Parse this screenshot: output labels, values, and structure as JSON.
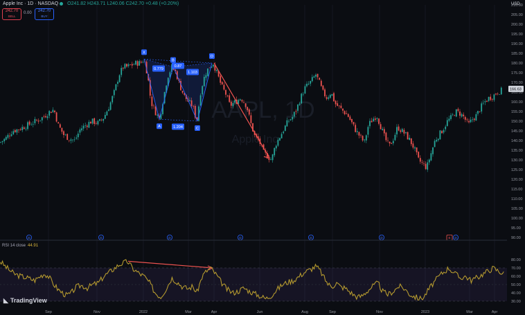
{
  "header": {
    "title": "Apple Inc · 1D · NASDAQ",
    "ohlc": "O241.82 H243.71 L240.06 C242.70 +0.48 (+0.20%)",
    "sell_value": "242.70",
    "sell_label": "SELL",
    "spread": "0.00",
    "buy_value": "242.70",
    "buy_label": "BUY",
    "currency": "USD"
  },
  "watermark": {
    "symbol": "AAPL, 1D",
    "name": "Apple Inc"
  },
  "rsi": {
    "label": "RSI 14 close",
    "value": "44.91"
  },
  "branding": "TradingView",
  "colors": {
    "up": "#26a69a",
    "down": "#ef5350",
    "pattern": "#2962ff",
    "arrow": "#ef5350",
    "rsi": "#b59a2f"
  },
  "pattern": {
    "points": [
      {
        "label": "X",
        "value": 182
      },
      {
        "label": "A",
        "value": 151
      },
      {
        "label": "B",
        "value": 178
      },
      {
        "label": "C",
        "value": 150
      },
      {
        "label": "D",
        "value": 180
      }
    ],
    "ratios": [
      "0.779",
      "0.87",
      "1.204",
      "1.103"
    ]
  },
  "events": [
    {
      "label": "D",
      "color": "#2962ff"
    },
    {
      "label": "E",
      "color": "#ef5350"
    }
  ],
  "chart_data": {
    "type": "candlestick",
    "price_axis": {
      "ylim": [
        90,
        210
      ],
      "ticks": [
        "210.00",
        "205.00",
        "200.00",
        "195.00",
        "190.00",
        "185.00",
        "180.00",
        "175.00",
        "170.00",
        "165.00",
        "160.00",
        "155.00",
        "150.00",
        "145.00",
        "140.00",
        "135.00",
        "130.00",
        "125.00",
        "120.00",
        "115.00",
        "110.00",
        "105.00",
        "100.00",
        "95.00",
        "90.00"
      ],
      "last_price": "166.63"
    },
    "x_ticks": [
      "Sep",
      "Nov",
      "2022",
      "Mar",
      "Apr",
      "Jun",
      "Aug",
      "Sep",
      "Nov",
      "2023",
      "Mar",
      "Apr"
    ],
    "close_path": [
      [
        0,
        139
      ],
      [
        8,
        141
      ],
      [
        18,
        145
      ],
      [
        28,
        146
      ],
      [
        40,
        148
      ],
      [
        52,
        150
      ],
      [
        62,
        152
      ],
      [
        72,
        155
      ],
      [
        78,
        156
      ],
      [
        84,
        148
      ],
      [
        92,
        143
      ],
      [
        100,
        141
      ],
      [
        108,
        140
      ],
      [
        116,
        146
      ],
      [
        124,
        148
      ],
      [
        132,
        150
      ],
      [
        142,
        149
      ],
      [
        150,
        152
      ],
      [
        158,
        158
      ],
      [
        165,
        165
      ],
      [
        172,
        174
      ],
      [
        178,
        178
      ],
      [
        184,
        178
      ],
      [
        190,
        179
      ],
      [
        197,
        180
      ],
      [
        203,
        180
      ],
      [
        208,
        182
      ],
      [
        213,
        174
      ],
      [
        218,
        160
      ],
      [
        224,
        155
      ],
      [
        230,
        151
      ],
      [
        236,
        162
      ],
      [
        242,
        173
      ],
      [
        248,
        178
      ],
      [
        254,
        175
      ],
      [
        260,
        168
      ],
      [
        266,
        163
      ],
      [
        272,
        160
      ],
      [
        278,
        158
      ],
      [
        284,
        150
      ],
      [
        290,
        166
      ],
      [
        296,
        174
      ],
      [
        302,
        178
      ],
      [
        308,
        180
      ],
      [
        314,
        174
      ],
      [
        320,
        168
      ],
      [
        326,
        164
      ],
      [
        332,
        158
      ],
      [
        340,
        160
      ],
      [
        348,
        162
      ],
      [
        356,
        158
      ],
      [
        362,
        149
      ],
      [
        368,
        142
      ],
      [
        374,
        140
      ],
      [
        380,
        134
      ],
      [
        386,
        132
      ],
      [
        392,
        130
      ],
      [
        398,
        138
      ],
      [
        404,
        142
      ],
      [
        410,
        146
      ],
      [
        416,
        150
      ],
      [
        422,
        152
      ],
      [
        428,
        156
      ],
      [
        434,
        162
      ],
      [
        440,
        167
      ],
      [
        448,
        170
      ],
      [
        456,
        174
      ],
      [
        461,
        170
      ],
      [
        466,
        165
      ],
      [
        472,
        162
      ],
      [
        478,
        165
      ],
      [
        484,
        159
      ],
      [
        490,
        157
      ],
      [
        496,
        155
      ],
      [
        502,
        153
      ],
      [
        508,
        149
      ],
      [
        514,
        145
      ],
      [
        520,
        142
      ],
      [
        526,
        139
      ],
      [
        532,
        148
      ],
      [
        538,
        151
      ],
      [
        544,
        153
      ],
      [
        550,
        147
      ],
      [
        556,
        141
      ],
      [
        562,
        137
      ],
      [
        568,
        141
      ],
      [
        574,
        147
      ],
      [
        580,
        145
      ],
      [
        586,
        143
      ],
      [
        592,
        140
      ],
      [
        598,
        136
      ],
      [
        604,
        130
      ],
      [
        610,
        128
      ],
      [
        616,
        126
      ],
      [
        622,
        133
      ],
      [
        628,
        140
      ],
      [
        634,
        143
      ],
      [
        640,
        146
      ],
      [
        646,
        150
      ],
      [
        652,
        152
      ],
      [
        658,
        155
      ],
      [
        664,
        154
      ],
      [
        670,
        152
      ],
      [
        676,
        148
      ],
      [
        682,
        151
      ],
      [
        688,
        153
      ],
      [
        694,
        157
      ],
      [
        700,
        160
      ],
      [
        706,
        162
      ],
      [
        712,
        163
      ],
      [
        718,
        165
      ],
      [
        726,
        166
      ]
    ],
    "rsi_axis": {
      "ylim": [
        30,
        80
      ],
      "ticks": [
        "80.00",
        "70.00",
        "60.00",
        "50.00",
        "40.00",
        "30.00"
      ],
      "overbought": 70,
      "oversold": 30
    },
    "rsi_path": [
      [
        0,
        78
      ],
      [
        10,
        70
      ],
      [
        20,
        63
      ],
      [
        30,
        60
      ],
      [
        40,
        58
      ],
      [
        50,
        55
      ],
      [
        58,
        60
      ],
      [
        64,
        63
      ],
      [
        70,
        60
      ],
      [
        76,
        52
      ],
      [
        84,
        44
      ],
      [
        90,
        40
      ],
      [
        96,
        37
      ],
      [
        102,
        39
      ],
      [
        110,
        47
      ],
      [
        118,
        49
      ],
      [
        126,
        46
      ],
      [
        134,
        50
      ],
      [
        142,
        52
      ],
      [
        150,
        60
      ],
      [
        158,
        65
      ],
      [
        166,
        70
      ],
      [
        172,
        74
      ],
      [
        178,
        76
      ],
      [
        184,
        78
      ],
      [
        192,
        69
      ],
      [
        200,
        64
      ],
      [
        208,
        60
      ],
      [
        216,
        52
      ],
      [
        224,
        40
      ],
      [
        232,
        35
      ],
      [
        240,
        45
      ],
      [
        248,
        58
      ],
      [
        256,
        53
      ],
      [
        264,
        47
      ],
      [
        272,
        45
      ],
      [
        278,
        48
      ],
      [
        284,
        40
      ],
      [
        292,
        60
      ],
      [
        298,
        66
      ],
      [
        304,
        70
      ],
      [
        312,
        62
      ],
      [
        320,
        52
      ],
      [
        328,
        44
      ],
      [
        336,
        40
      ],
      [
        344,
        42
      ],
      [
        352,
        46
      ],
      [
        360,
        42
      ],
      [
        368,
        39
      ],
      [
        376,
        36
      ],
      [
        384,
        33
      ],
      [
        392,
        37
      ],
      [
        400,
        44
      ],
      [
        408,
        50
      ],
      [
        416,
        53
      ],
      [
        424,
        55
      ],
      [
        432,
        60
      ],
      [
        440,
        65
      ],
      [
        448,
        68
      ],
      [
        456,
        72
      ],
      [
        462,
        67
      ],
      [
        468,
        58
      ],
      [
        474,
        50
      ],
      [
        480,
        48
      ],
      [
        486,
        52
      ],
      [
        492,
        47
      ],
      [
        498,
        46
      ],
      [
        504,
        42
      ],
      [
        510,
        38
      ],
      [
        516,
        35
      ],
      [
        522,
        36
      ],
      [
        530,
        42
      ],
      [
        538,
        48
      ],
      [
        546,
        52
      ],
      [
        552,
        42
      ],
      [
        560,
        38
      ],
      [
        568,
        42
      ],
      [
        576,
        48
      ],
      [
        584,
        45
      ],
      [
        592,
        38
      ],
      [
        600,
        35
      ],
      [
        606,
        33
      ],
      [
        612,
        35
      ],
      [
        618,
        43
      ],
      [
        624,
        50
      ],
      [
        630,
        56
      ],
      [
        636,
        62
      ],
      [
        642,
        66
      ],
      [
        648,
        70
      ],
      [
        656,
        64
      ],
      [
        664,
        58
      ],
      [
        672,
        60
      ],
      [
        680,
        55
      ],
      [
        688,
        58
      ],
      [
        696,
        62
      ],
      [
        704,
        66
      ],
      [
        712,
        70
      ],
      [
        720,
        66
      ],
      [
        728,
        63
      ]
    ]
  }
}
